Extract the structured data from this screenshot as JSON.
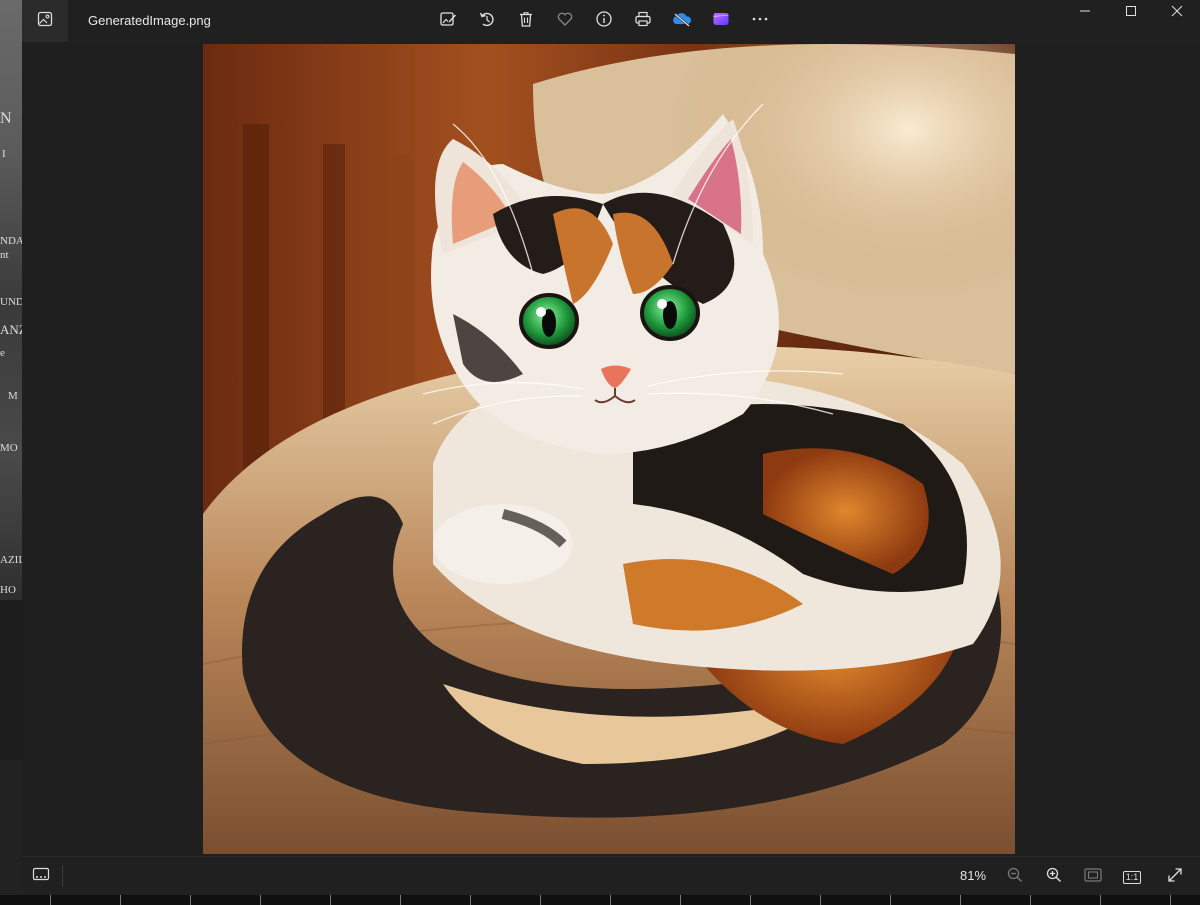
{
  "window": {
    "title": "GeneratedImage.png"
  },
  "toolbar": {
    "items": [
      {
        "icon": "edit-image-icon"
      },
      {
        "icon": "rotate-icon"
      },
      {
        "icon": "delete-icon"
      },
      {
        "icon": "favorite-heart-icon"
      },
      {
        "icon": "info-icon"
      },
      {
        "icon": "print-icon"
      },
      {
        "icon": "onedrive-cloud-icon"
      },
      {
        "icon": "clipchamp-icon"
      },
      {
        "icon": "more-options-icon"
      }
    ]
  },
  "window_controls": [
    "minimize-icon",
    "maximize-icon",
    "close-icon"
  ],
  "image": {
    "subject": "calico kitten curled on a cushion"
  },
  "bottombar": {
    "zoom_level": "81%",
    "actual_size_label": "1:1"
  },
  "background_labels": [
    "N",
    "I",
    "NDA",
    "nt",
    "UND",
    "ANZ",
    "e",
    "M",
    "MO",
    "AZIL",
    "HO"
  ],
  "colors": {
    "window_bg": "#202020",
    "accent_purple": "#7b5cff",
    "onedrive_blue": "#2f8ce8"
  }
}
